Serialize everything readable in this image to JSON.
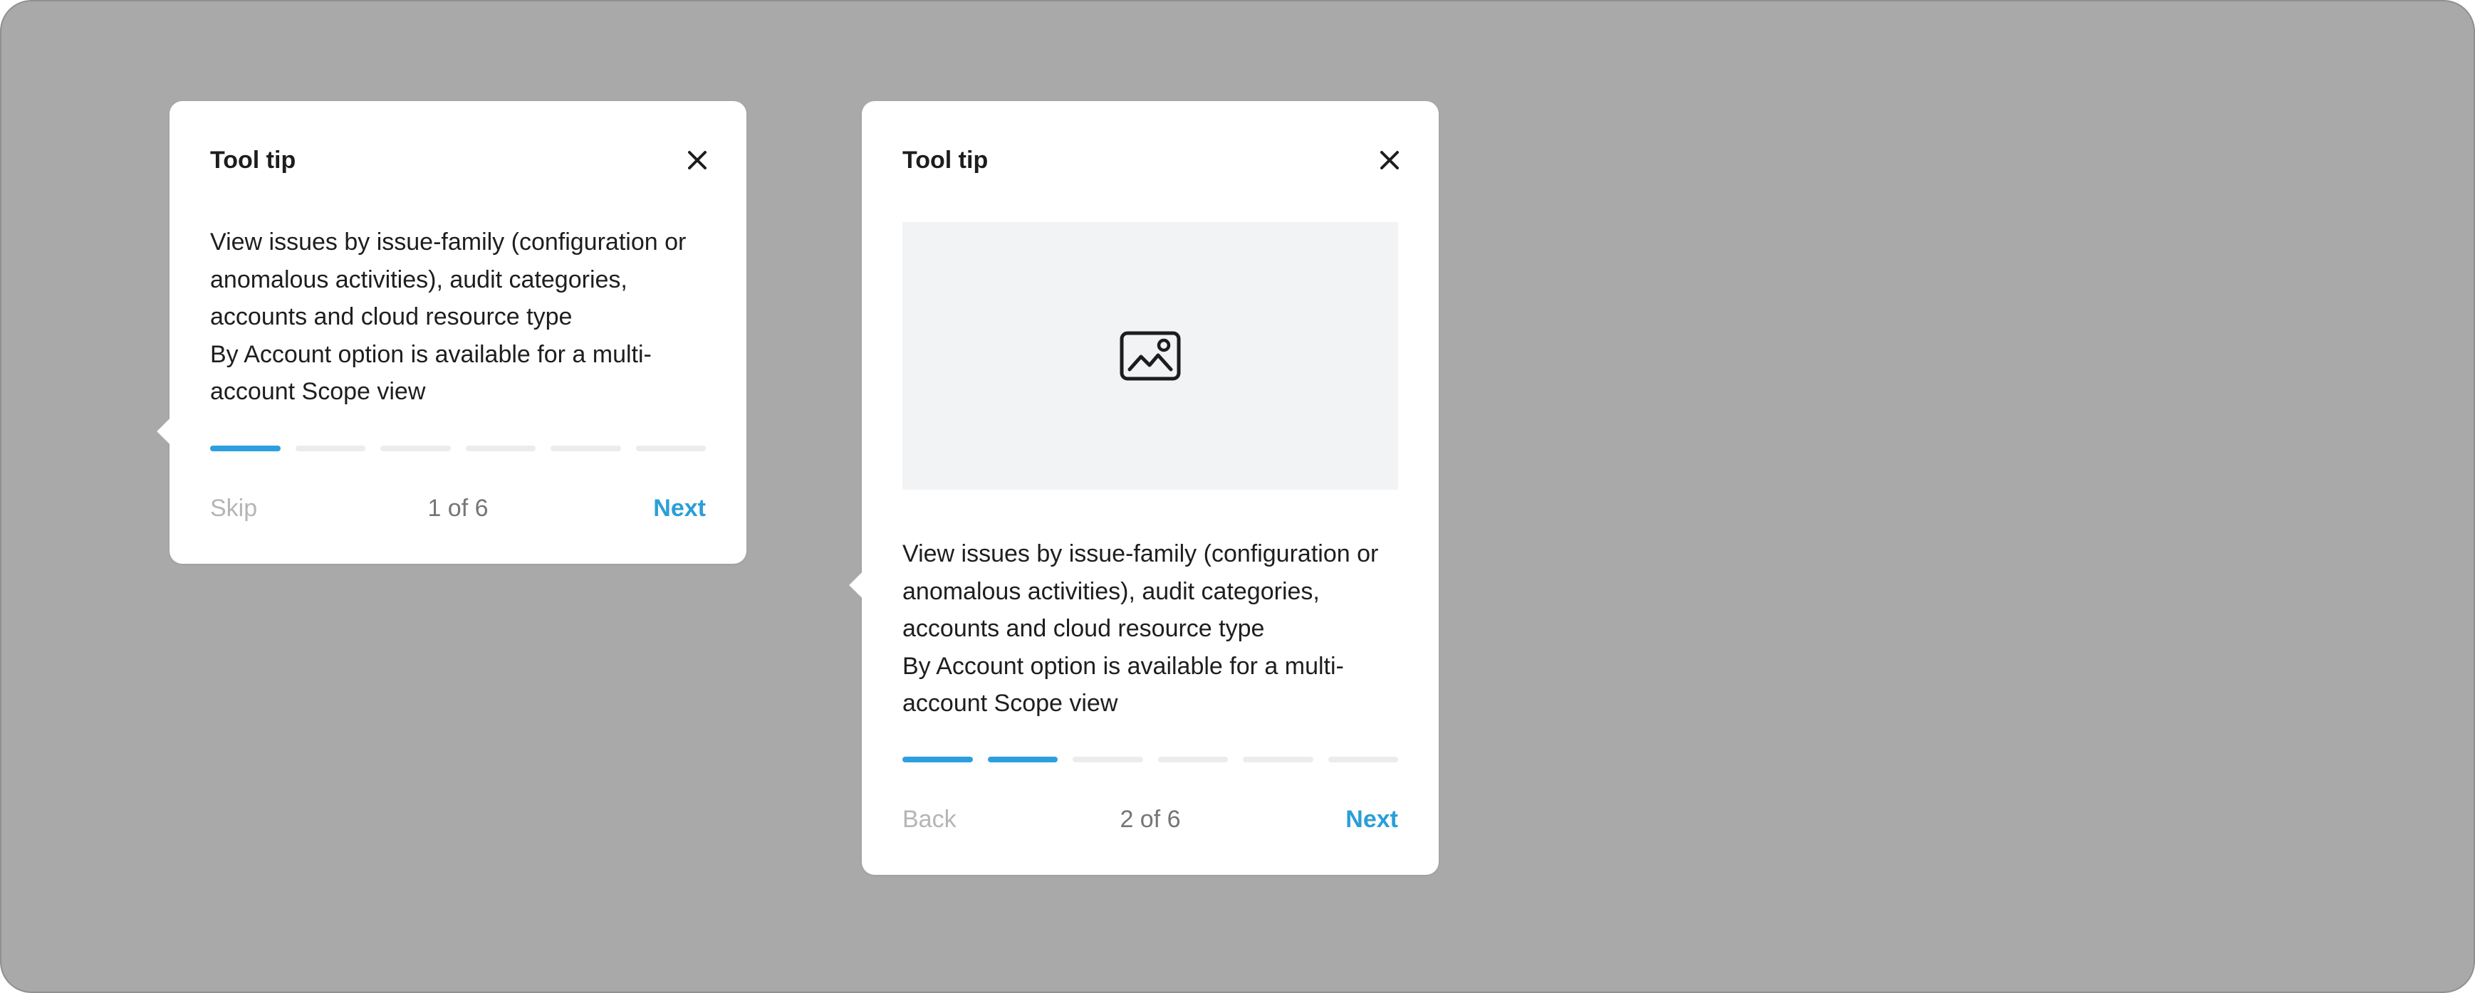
{
  "colors": {
    "backdrop": "#a9a9a9",
    "accent": "#2d9fe0",
    "progress_inactive": "#ececec",
    "media_placeholder": "#f2f3f4"
  },
  "tooltips": [
    {
      "title": "Tool tip",
      "close_icon": "close-icon",
      "body": [
        "View issues by issue-family (configuration or anomalous activities), audit categories, accounts and cloud resource type",
        "By Account option is available for a multi-account Scope view"
      ],
      "progress": {
        "current": 1,
        "total": 6
      },
      "footer": {
        "secondary_label": "Skip",
        "counter": "1 of 6",
        "primary_label": "Next"
      }
    },
    {
      "title": "Tool tip",
      "close_icon": "close-icon",
      "media_icon": "image-icon",
      "body": [
        "View issues by issue-family (configuration or anomalous activities), audit categories, accounts and cloud resource type",
        "By Account option is available for a multi-account Scope view"
      ],
      "progress": {
        "current": 2,
        "total": 6
      },
      "footer": {
        "secondary_label": "Back",
        "counter": "2 of 6",
        "primary_label": "Next"
      }
    }
  ]
}
